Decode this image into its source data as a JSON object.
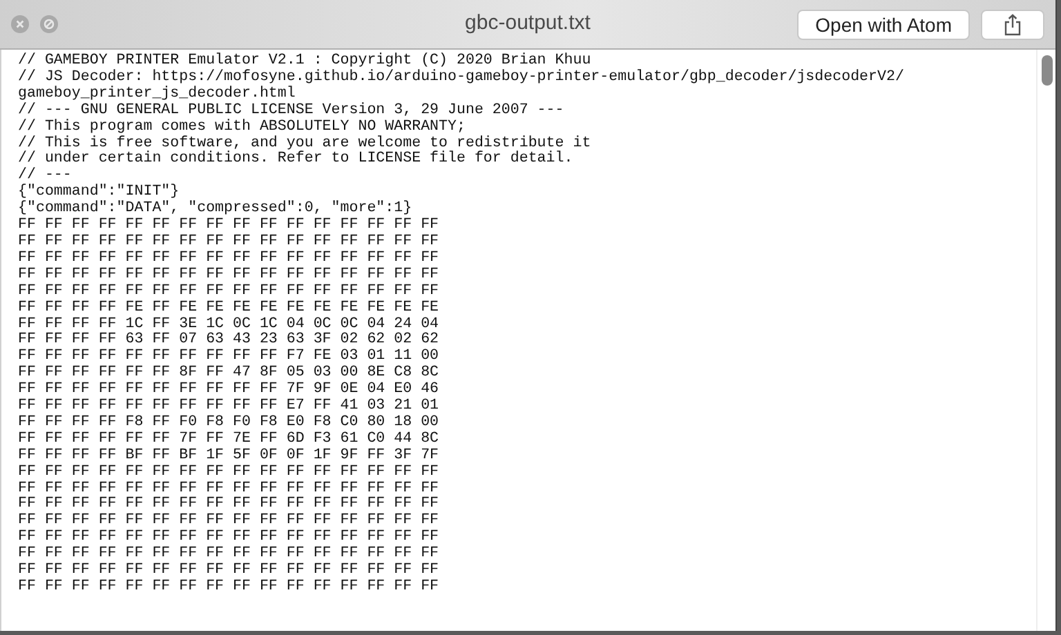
{
  "window": {
    "title": "gbc-output.txt"
  },
  "toolbar": {
    "open_button": "Open with Atom"
  },
  "lines": [
    "// GAMEBOY PRINTER Emulator V2.1 : Copyright (C) 2020 Brian Khuu",
    "// JS Decoder: https://mofosyne.github.io/arduino-gameboy-printer-emulator/gbp_decoder/jsdecoderV2/",
    "gameboy_printer_js_decoder.html",
    "// --- GNU GENERAL PUBLIC LICENSE Version 3, 29 June 2007 ---",
    "// This program comes with ABSOLUTELY NO WARRANTY;",
    "// This is free software, and you are welcome to redistribute it",
    "// under certain conditions. Refer to LICENSE file for detail.",
    "// ---",
    "{\"command\":\"INIT\"}",
    "{\"command\":\"DATA\", \"compressed\":0, \"more\":1}",
    "FF FF FF FF FF FF FF FF FF FF FF FF FF FF FF FF",
    "FF FF FF FF FF FF FF FF FF FF FF FF FF FF FF FF",
    "FF FF FF FF FF FF FF FF FF FF FF FF FF FF FF FF",
    "FF FF FF FF FF FF FF FF FF FF FF FF FF FF FF FF",
    "FF FF FF FF FF FF FF FF FF FF FF FF FF FF FF FF",
    "FF FF FF FF FE FF FE FE FE FE FE FE FE FE FE FE",
    "FF FF FF FF 1C FF 3E 1C 0C 1C 04 0C 0C 04 24 04",
    "FF FF FF FF 63 FF 07 63 43 23 63 3F 02 62 02 62",
    "FF FF FF FF FF FF FF FF FF FF F7 FE 03 01 11 00",
    "FF FF FF FF FF FF 8F FF 47 8F 05 03 00 8E C8 8C",
    "FF FF FF FF FF FF FF FF FF FF 7F 9F 0E 04 E0 46",
    "FF FF FF FF FF FF FF FF FF FF E7 FF 41 03 21 01",
    "FF FF FF FF F8 FF F0 F8 F0 F8 E0 F8 C0 80 18 00",
    "FF FF FF FF FF FF 7F FF 7E FF 6D F3 61 C0 44 8C",
    "FF FF FF FF BF FF BF 1F 5F 0F 0F 1F 9F FF 3F 7F",
    "FF FF FF FF FF FF FF FF FF FF FF FF FF FF FF FF",
    "FF FF FF FF FF FF FF FF FF FF FF FF FF FF FF FF",
    "FF FF FF FF FF FF FF FF FF FF FF FF FF FF FF FF",
    "FF FF FF FF FF FF FF FF FF FF FF FF FF FF FF FF",
    "FF FF FF FF FF FF FF FF FF FF FF FF FF FF FF FF",
    "FF FF FF FF FF FF FF FF FF FF FF FF FF FF FF FF",
    "FF FF FF FF FF FF FF FF FF FF FF FF FF FF FF FF",
    "FF FF FF FF FF FF FF FF FF FF FF FF FF FF FF FF"
  ]
}
